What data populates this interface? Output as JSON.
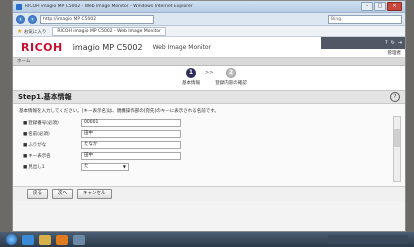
{
  "browser": {
    "title": "RICOH imagio MP C5002 - Web Image Monitor - Windows Internet Explorer",
    "address": "http://imagio MP C5002",
    "search_placeholder": "Bing",
    "favorites_label": "お気に入り",
    "tab_label": "RICOH imagio MP C5002 - Web Image Monitor"
  },
  "app": {
    "brand": "RICOH",
    "model": "imagio MP C5002",
    "subtitle": "Web Image Monitor",
    "user_label": "管理者",
    "home_label": "ホーム"
  },
  "steps": {
    "step1_number": "1",
    "step1_label": "基本情報",
    "step2_number": "2",
    "step2_label": "登録内容の確認",
    "arrow": ">>"
  },
  "section": {
    "title": "Step1.基本情報",
    "help": "?"
  },
  "instructions": "基本情報を入力してください。[キー表示名]は、親機操作部の[宛先]のキーに表示される名前です。",
  "form": {
    "fields": [
      {
        "label": "登録番号(必須)",
        "value": "00001"
      },
      {
        "label": "名前(必須)",
        "value": "田中"
      },
      {
        "label": "ふりがな",
        "value": "たなか"
      },
      {
        "label": "キー表示名",
        "value": "田中"
      },
      {
        "label": "見出し1",
        "value": "た"
      }
    ]
  },
  "buttons": {
    "back": "戻る",
    "next": "次へ",
    "cancel": "キャンセル"
  }
}
